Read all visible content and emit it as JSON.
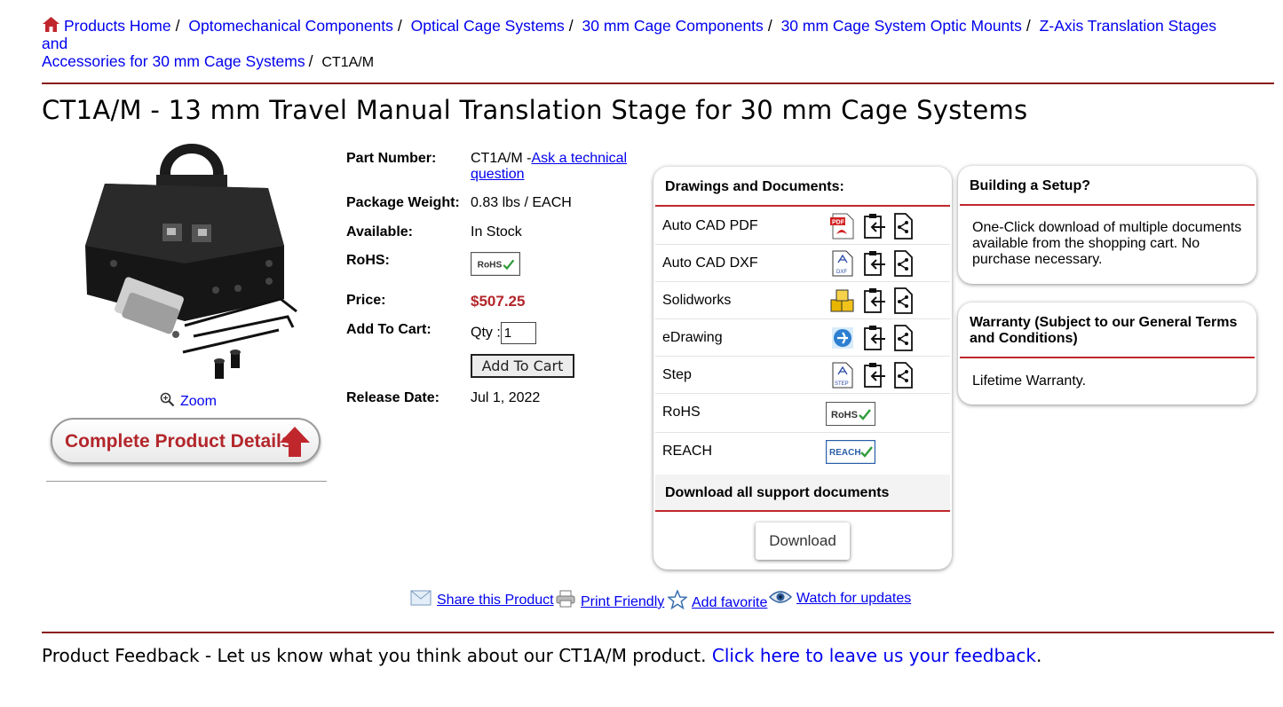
{
  "breadcrumb": {
    "items": [
      "Products Home",
      "Optomechanical Components",
      "Optical Cage Systems",
      "30 mm Cage Components",
      "30 mm Cage System Optic Mounts",
      "Z-Axis Translation Stages and",
      "Accessories for 30 mm Cage Systems"
    ],
    "current": "CT1A/M"
  },
  "title": "CT1A/M - 13 mm Travel Manual Translation Stage for 30 mm Cage Systems",
  "zoom_label": "Zoom",
  "details_button": "Complete Product Details",
  "info": {
    "part_number_label": "Part Number:",
    "part_number": "CT1A/M -",
    "ask_link": "Ask a technical question",
    "weight_label": "Package Weight:",
    "weight": "0.83 lbs / EACH",
    "available_label": "Available:",
    "available": "In Stock",
    "rohs_label": "RoHS:",
    "price_label": "Price:",
    "price": "$507.25",
    "cart_label": "Add To Cart:",
    "qty_label": "Qty :",
    "qty_value": "1",
    "cart_button": "Add To Cart",
    "release_label": "Release Date:",
    "release": "Jul 1, 2022"
  },
  "badge_rohs": "RoHS",
  "badge_reach": "REACH",
  "icon_pdf": "PDF",
  "icon_dxf": "DXF",
  "icon_step": "STEP",
  "docs": {
    "title": "Drawings and Documents:",
    "rows": [
      "Auto CAD PDF",
      "Auto CAD DXF",
      "Solidworks",
      "eDrawing",
      "Step",
      "RoHS",
      "REACH"
    ],
    "download_all": "Download all support documents",
    "download_button": "Download"
  },
  "setup": {
    "title": "Building a Setup?",
    "text": "One-Click download of multiple documents available from the shopping cart. No purchase necessary."
  },
  "warranty": {
    "title": "Warranty (Subject to our General Terms and Conditions)",
    "text": "Lifetime Warranty."
  },
  "actions": {
    "share": "Share this Product",
    "print": "Print Friendly",
    "favorite": "Add favorite",
    "watch": "Watch for updates"
  },
  "feedback": {
    "text": "Product Feedback - Let us know what you think about our CT1A/M product.",
    "link": "Click here to leave us your feedback",
    "end": "."
  },
  "colors": {
    "accent_red": "#b3262b",
    "rule": "#8b1a1a",
    "link": "#0000ee"
  }
}
